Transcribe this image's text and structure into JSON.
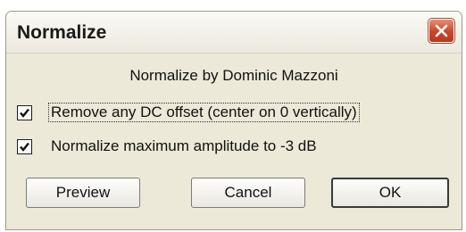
{
  "window": {
    "title": "Normalize",
    "close_icon": "close-icon",
    "accent": "#c7462c"
  },
  "content": {
    "author_line": "Normalize by Dominic Mazzoni",
    "options": [
      {
        "label": "Remove any DC offset (center on 0 vertically)",
        "checked": true
      },
      {
        "label": "Normalize maximum amplitude to -3 dB",
        "checked": true
      }
    ]
  },
  "buttons": {
    "preview": "Preview",
    "cancel": "Cancel",
    "ok": "OK"
  }
}
